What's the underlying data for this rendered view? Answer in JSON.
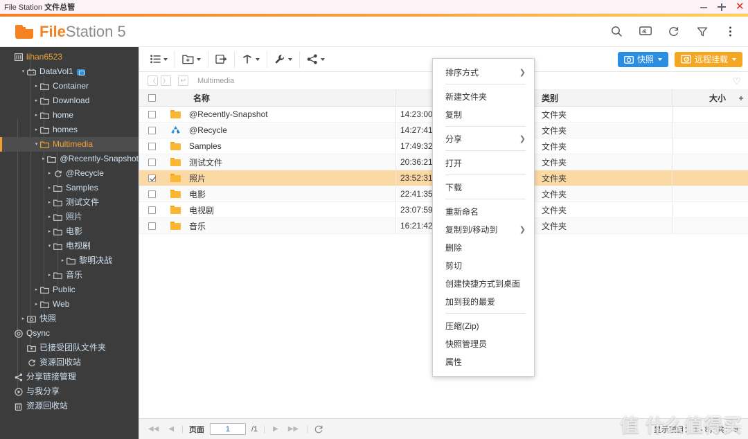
{
  "window": {
    "title_en": "File Station ",
    "title_cn": "文件总管",
    "buttons": {
      "minimize": "minimize-icon",
      "maximize": "maximize-icon",
      "close": "close-icon"
    }
  },
  "header": {
    "logo_icon": "folder-icon",
    "app_name_bold": "File",
    "app_name_rest": "Station",
    "app_version": " 5",
    "icons": [
      "search-icon",
      "cast-icon",
      "refresh-icon",
      "filter-icon",
      "more-vertical-icon"
    ]
  },
  "sidebar": {
    "items": [
      {
        "label": "lihan6523",
        "icon": "server-icon",
        "indent": 0,
        "arrow": "",
        "style": "accent"
      },
      {
        "label": "DataVol1",
        "icon": "volume-icon",
        "indent": 1,
        "arrow": "down",
        "style": "blue",
        "badge": true
      },
      {
        "label": "Container",
        "icon": "folder-outline-icon",
        "indent": 2,
        "arrow": "right",
        "style": "blue"
      },
      {
        "label": "Download",
        "icon": "folder-outline-icon",
        "indent": 2,
        "arrow": "right",
        "style": "blue"
      },
      {
        "label": "home",
        "icon": "folder-outline-icon",
        "indent": 2,
        "arrow": "right",
        "style": "blue"
      },
      {
        "label": "homes",
        "icon": "folder-outline-icon",
        "indent": 2,
        "arrow": "right",
        "style": "blue"
      },
      {
        "label": "Multimedia",
        "icon": "folder-open-icon",
        "indent": 2,
        "arrow": "down",
        "style": "selected"
      },
      {
        "label": "@Recently-Snapshot",
        "icon": "folder-outline-icon",
        "indent": 3,
        "arrow": "right",
        "style": "blue"
      },
      {
        "label": "@Recycle",
        "icon": "recycle-icon",
        "indent": 3,
        "arrow": "right",
        "style": "blue"
      },
      {
        "label": "Samples",
        "icon": "folder-outline-icon",
        "indent": 3,
        "arrow": "right",
        "style": "blue"
      },
      {
        "label": "测试文件",
        "icon": "folder-outline-icon",
        "indent": 3,
        "arrow": "right",
        "style": "blue"
      },
      {
        "label": "照片",
        "icon": "folder-outline-icon",
        "indent": 3,
        "arrow": "right",
        "style": "blue"
      },
      {
        "label": "电影",
        "icon": "folder-outline-icon",
        "indent": 3,
        "arrow": "right",
        "style": "blue"
      },
      {
        "label": "电视剧",
        "icon": "folder-outline-icon",
        "indent": 3,
        "arrow": "down",
        "style": "blue"
      },
      {
        "label": "黎明决战",
        "icon": "folder-outline-icon",
        "indent": 4,
        "arrow": "right",
        "style": "blue"
      },
      {
        "label": "音乐",
        "icon": "folder-outline-icon",
        "indent": 3,
        "arrow": "right",
        "style": "blue"
      },
      {
        "label": "Public",
        "icon": "folder-outline-icon",
        "indent": 2,
        "arrow": "right",
        "style": "blue"
      },
      {
        "label": "Web",
        "icon": "folder-outline-icon",
        "indent": 2,
        "arrow": "right",
        "style": "blue"
      },
      {
        "label": "快照",
        "icon": "snapshot-icon",
        "indent": 1,
        "arrow": "right",
        "style": "blue"
      },
      {
        "label": "Qsync",
        "icon": "qsync-icon",
        "indent": 0,
        "arrow": "",
        "style": "blue"
      },
      {
        "label": "已接受团队文件夹",
        "icon": "team-folder-icon",
        "indent": 1,
        "arrow": "",
        "style": "blue"
      },
      {
        "label": "资源回收站",
        "icon": "recycle-icon",
        "indent": 1,
        "arrow": "",
        "style": "blue"
      },
      {
        "label": "分享链接管理",
        "icon": "share-icon",
        "indent": 0,
        "arrow": "",
        "style": "blue"
      },
      {
        "label": "与我分享",
        "icon": "shared-with-me-icon",
        "indent": 0,
        "arrow": "",
        "style": "blue"
      },
      {
        "label": "资源回收站",
        "icon": "trash-icon",
        "indent": 0,
        "arrow": "",
        "style": "blue"
      }
    ]
  },
  "toolbar": {
    "groups": [
      {
        "icon": "list-view-icon",
        "has_caret": true
      },
      {
        "icon": "new-folder-icon",
        "has_caret": true
      },
      {
        "icon": "copy-to-icon",
        "has_caret": false
      },
      {
        "icon": "upload-icon",
        "has_caret": true
      },
      {
        "icon": "tools-icon",
        "has_caret": true
      },
      {
        "icon": "share-icon",
        "has_caret": true
      }
    ],
    "snapshot_button": {
      "label": "快照",
      "icon": "snapshot-icon",
      "color": "#2a8fe0"
    },
    "remote_mount_button": {
      "label": "远程挂载",
      "icon": "remote-mount-icon",
      "color": "#f5a623"
    }
  },
  "breadcrumb": {
    "back_icon": "chevron-left-icon",
    "forward_icon": "chevron-right-icon",
    "up_icon": "arrow-up-back-icon",
    "path": "Multimedia",
    "favorite_icon": "heart-icon"
  },
  "table": {
    "columns": [
      "名称",
      "",
      "类别",
      "大小"
    ],
    "header_name": "名称",
    "header_date": "",
    "header_type": "类别",
    "header_size": "大小",
    "add_column": "+",
    "rows": [
      {
        "name": "@Recently-Snapshot",
        "icon": "folder-icon",
        "date": "14:23:00",
        "type": "文件夹",
        "size": "",
        "selected": false
      },
      {
        "name": "@Recycle",
        "icon": "recycle-icon",
        "date": "14:27:41",
        "type": "文件夹",
        "size": "",
        "selected": false
      },
      {
        "name": "Samples",
        "icon": "folder-icon",
        "date": "17:49:32",
        "type": "文件夹",
        "size": "",
        "selected": false
      },
      {
        "name": "测试文件",
        "icon": "folder-icon",
        "date": "20:36:21",
        "type": "文件夹",
        "size": "",
        "selected": false
      },
      {
        "name": "照片",
        "icon": "folder-icon",
        "date": "23:52:31",
        "type": "文件夹",
        "size": "",
        "selected": true
      },
      {
        "name": "电影",
        "icon": "folder-icon",
        "date": "22:41:35",
        "type": "文件夹",
        "size": "",
        "selected": false
      },
      {
        "name": "电视剧",
        "icon": "folder-icon",
        "date": "23:07:59",
        "type": "文件夹",
        "size": "",
        "selected": false
      },
      {
        "name": "音乐",
        "icon": "folder-icon",
        "date": "16:21:42",
        "type": "文件夹",
        "size": "",
        "selected": false
      }
    ]
  },
  "context_menu": {
    "items": [
      {
        "label": "排序方式",
        "submenu": true
      },
      {
        "divider": true
      },
      {
        "label": "新建文件夹",
        "submenu": false
      },
      {
        "label": "复制",
        "submenu": false
      },
      {
        "divider": true
      },
      {
        "label": "分享",
        "submenu": true
      },
      {
        "divider": true
      },
      {
        "label": "打开",
        "submenu": false
      },
      {
        "divider": true
      },
      {
        "label": "下载",
        "submenu": false
      },
      {
        "divider": true
      },
      {
        "label": "重新命名",
        "submenu": false
      },
      {
        "label": "复制到/移动到",
        "submenu": true
      },
      {
        "label": "删除",
        "submenu": false
      },
      {
        "label": "剪切",
        "submenu": false
      },
      {
        "label": "创建快捷方式到桌面",
        "submenu": false
      },
      {
        "label": "加到我的最爱",
        "submenu": false
      },
      {
        "divider": true
      },
      {
        "label": "压缩(Zip)",
        "submenu": false
      },
      {
        "label": "快照管理员",
        "submenu": false
      },
      {
        "label": "属性",
        "submenu": false
      }
    ]
  },
  "footer": {
    "first_icon": "first-page-icon",
    "prev_icon": "prev-page-icon",
    "page_label": "页面",
    "page_value": "1",
    "page_total": "/1",
    "next_icon": "next-page-icon",
    "last_icon": "last-page-icon",
    "refresh_icon": "refresh-icon",
    "status": "显示项目： 1 - 8，共： 8"
  },
  "watermark": "值 什么值得买"
}
